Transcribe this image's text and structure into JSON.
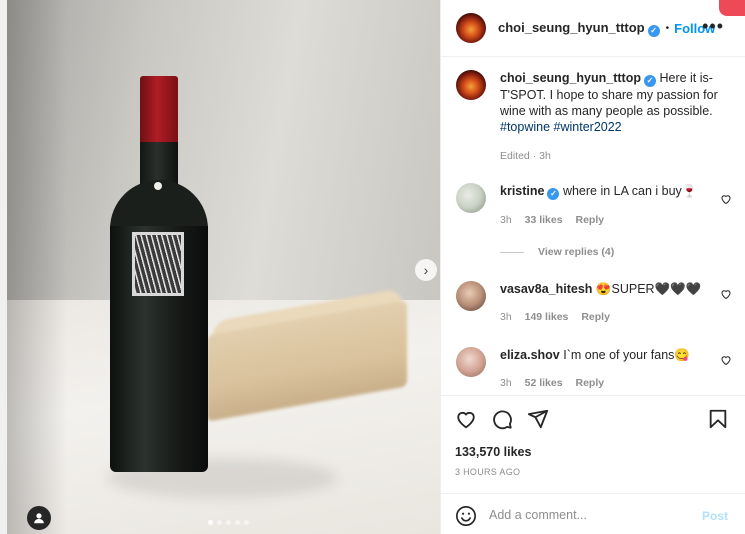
{
  "post": {
    "author": "choi_seung_hyun_tttop",
    "follow_label": "Follow",
    "separator": "•",
    "more_label": "•••",
    "caption_text": "Here it is- T'SPOT. I hope to share my passion for wine with as many people as possible.",
    "caption_hashtags": [
      "#topwine",
      "#winter2022"
    ],
    "caption_meta": "Edited · 3h",
    "likes_count": "133,570 likes",
    "time_ago": "3 HOURS AGO"
  },
  "comments": [
    {
      "user": "kristine",
      "text": "where in LA can i buy🍷",
      "time": "3h",
      "likes": "33 likes",
      "reply": "Reply",
      "verified": true
    },
    {
      "user": "vasav8a_hitesh",
      "text": "😍SUPER🖤🖤🖤",
      "time": "3h",
      "likes": "149 likes",
      "reply": "Reply",
      "verified": false
    },
    {
      "user": "eliza.shov",
      "text": "I`m one of your fans😋",
      "time": "3h",
      "likes": "52 likes",
      "reply": "Reply",
      "verified": false
    }
  ],
  "view_replies": "View replies (4)",
  "comment_box": {
    "placeholder": "Add a comment...",
    "post_label": "Post"
  },
  "carousel": {
    "slides": 5,
    "active_index": 0
  },
  "colors": {
    "link": "#0095f6",
    "hashtag": "#00376b",
    "muted": "#8e8e8e",
    "notification": "#ed4956"
  },
  "icons": [
    "heart-icon",
    "comment-icon",
    "share-icon",
    "bookmark-icon",
    "emoji-icon",
    "user-tag-icon",
    "chevron-right-icon",
    "verified-icon",
    "more-icon"
  ]
}
